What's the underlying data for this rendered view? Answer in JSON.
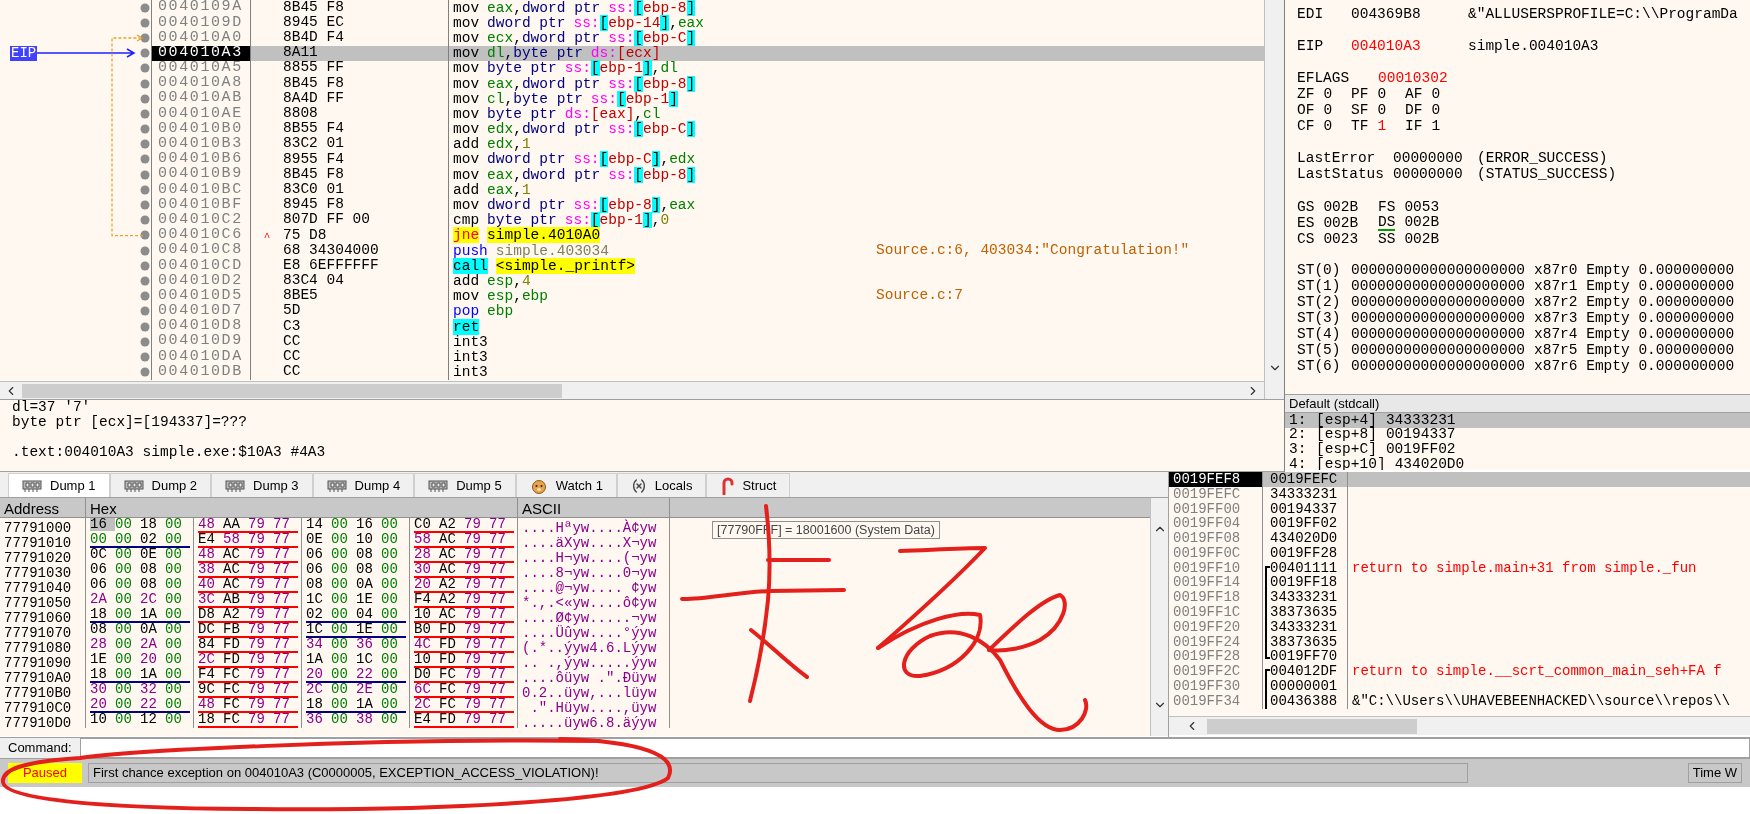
{
  "disassembly": {
    "rows": [
      {
        "address": "0040109A",
        "bytes": "8B45 F8",
        "tokens": [
          {
            "text": "mov",
            "kind": "mnemonic"
          },
          {
            "text": "eax",
            "kind": "reg"
          },
          {
            "text": ",",
            "kind": "sep"
          },
          {
            "text": "dword ptr",
            "kind": "size"
          },
          {
            "text": "ss:",
            "kind": "seg"
          },
          {
            "text": "[",
            "kind": "bracket"
          },
          {
            "text": "ebp-8",
            "kind": "mem"
          },
          {
            "text": "]",
            "kind": "bracket"
          }
        ],
        "selected": false
      },
      {
        "address": "0040109D",
        "bytes": "8945 EC",
        "tokens": [
          {
            "text": "mov",
            "kind": "mnemonic"
          },
          {
            "text": "dword ptr",
            "kind": "size"
          },
          {
            "text": "ss:",
            "kind": "seg"
          },
          {
            "text": "[",
            "kind": "bracket"
          },
          {
            "text": "ebp-14",
            "kind": "mem"
          },
          {
            "text": "]",
            "kind": "bracket"
          },
          {
            "text": ",",
            "kind": "sep"
          },
          {
            "text": "eax",
            "kind": "reg"
          }
        ],
        "selected": false
      },
      {
        "address": "004010A0",
        "bytes": "8B4D F4",
        "tokens": [
          {
            "text": "mov",
            "kind": "mnemonic"
          },
          {
            "text": "ecx",
            "kind": "reg"
          },
          {
            "text": ",",
            "kind": "sep"
          },
          {
            "text": "dword ptr",
            "kind": "size"
          },
          {
            "text": "ss:",
            "kind": "seg"
          },
          {
            "text": "[",
            "kind": "bracket"
          },
          {
            "text": "ebp-C",
            "kind": "mem"
          },
          {
            "text": "]",
            "kind": "bracket"
          }
        ],
        "selected": false,
        "kind": "jump_target"
      },
      {
        "address": "004010A3",
        "bytes": "8A11",
        "tokens": [
          {
            "text": "mov",
            "kind": "mnemonic"
          },
          {
            "text": "dl",
            "kind": "reg"
          },
          {
            "text": ",",
            "kind": "sep"
          },
          {
            "text": "byte ptr",
            "kind": "size"
          },
          {
            "text": "ds:",
            "kind": "seg"
          },
          {
            "text": "[ecx]",
            "kind": "mem"
          }
        ],
        "selected": true,
        "eip_label": "EIP"
      },
      {
        "address": "004010A5",
        "bytes": "8855 FF",
        "tokens": [
          {
            "text": "mov",
            "kind": "mnemonic"
          },
          {
            "text": "byte ptr",
            "kind": "size"
          },
          {
            "text": "ss:",
            "kind": "seg"
          },
          {
            "text": "[",
            "kind": "bracket"
          },
          {
            "text": "ebp-1",
            "kind": "mem"
          },
          {
            "text": "]",
            "kind": "bracket"
          },
          {
            "text": ",",
            "kind": "sep"
          },
          {
            "text": "dl",
            "kind": "reg"
          }
        ],
        "selected": false
      },
      {
        "address": "004010A8",
        "bytes": "8B45 F8",
        "tokens": [
          {
            "text": "mov",
            "kind": "mnemonic"
          },
          {
            "text": "eax",
            "kind": "reg"
          },
          {
            "text": ",",
            "kind": "sep"
          },
          {
            "text": "dword ptr",
            "kind": "size"
          },
          {
            "text": "ss:",
            "kind": "seg"
          },
          {
            "text": "[",
            "kind": "bracket"
          },
          {
            "text": "ebp-8",
            "kind": "mem"
          },
          {
            "text": "]",
            "kind": "bracket"
          }
        ],
        "selected": false
      },
      {
        "address": "004010AB",
        "bytes": "8A4D FF",
        "tokens": [
          {
            "text": "mov",
            "kind": "mnemonic"
          },
          {
            "text": "cl",
            "kind": "reg"
          },
          {
            "text": ",",
            "kind": "sep"
          },
          {
            "text": "byte ptr",
            "kind": "size"
          },
          {
            "text": "ss:",
            "kind": "seg"
          },
          {
            "text": "[",
            "kind": "bracket"
          },
          {
            "text": "ebp-1",
            "kind": "mem"
          },
          {
            "text": "]",
            "kind": "bracket"
          }
        ],
        "selected": false
      },
      {
        "address": "004010AE",
        "bytes": "8808",
        "tokens": [
          {
            "text": "mov",
            "kind": "mnemonic"
          },
          {
            "text": "byte ptr",
            "kind": "size"
          },
          {
            "text": "ds:",
            "kind": "seg"
          },
          {
            "text": "[eax]",
            "kind": "mem"
          },
          {
            "text": ",",
            "kind": "sep"
          },
          {
            "text": "cl",
            "kind": "reg"
          }
        ],
        "selected": false
      },
      {
        "address": "004010B0",
        "bytes": "8B55 F4",
        "tokens": [
          {
            "text": "mov",
            "kind": "mnemonic"
          },
          {
            "text": "edx",
            "kind": "reg"
          },
          {
            "text": ",",
            "kind": "sep"
          },
          {
            "text": "dword ptr",
            "kind": "size"
          },
          {
            "text": "ss:",
            "kind": "seg"
          },
          {
            "text": "[",
            "kind": "bracket"
          },
          {
            "text": "ebp-C",
            "kind": "mem"
          },
          {
            "text": "]",
            "kind": "bracket"
          }
        ],
        "selected": false
      },
      {
        "address": "004010B3",
        "bytes": "83C2 01",
        "tokens": [
          {
            "text": "add",
            "kind": "mnemonic"
          },
          {
            "text": "edx",
            "kind": "reg"
          },
          {
            "text": ",",
            "kind": "sep"
          },
          {
            "text": "1",
            "kind": "num"
          }
        ],
        "selected": false
      },
      {
        "address": "004010B6",
        "bytes": "8955 F4",
        "tokens": [
          {
            "text": "mov",
            "kind": "mnemonic"
          },
          {
            "text": "dword ptr",
            "kind": "size"
          },
          {
            "text": "ss:",
            "kind": "seg"
          },
          {
            "text": "[",
            "kind": "bracket"
          },
          {
            "text": "ebp-C",
            "kind": "mem"
          },
          {
            "text": "]",
            "kind": "bracket"
          },
          {
            "text": ",",
            "kind": "sep"
          },
          {
            "text": "edx",
            "kind": "reg"
          }
        ],
        "selected": false
      },
      {
        "address": "004010B9",
        "bytes": "8B45 F8",
        "tokens": [
          {
            "text": "mov",
            "kind": "mnemonic"
          },
          {
            "text": "eax",
            "kind": "reg"
          },
          {
            "text": ",",
            "kind": "sep"
          },
          {
            "text": "dword ptr",
            "kind": "size"
          },
          {
            "text": "ss:",
            "kind": "seg"
          },
          {
            "text": "[",
            "kind": "bracket"
          },
          {
            "text": "ebp-8",
            "kind": "mem"
          },
          {
            "text": "]",
            "kind": "bracket"
          }
        ],
        "selected": false
      },
      {
        "address": "004010BC",
        "bytes": "83C0 01",
        "tokens": [
          {
            "text": "add",
            "kind": "mnemonic"
          },
          {
            "text": "eax",
            "kind": "reg"
          },
          {
            "text": ",",
            "kind": "sep"
          },
          {
            "text": "1",
            "kind": "num"
          }
        ],
        "selected": false
      },
      {
        "address": "004010BF",
        "bytes": "8945 F8",
        "tokens": [
          {
            "text": "mov",
            "kind": "mnemonic"
          },
          {
            "text": "dword ptr",
            "kind": "size"
          },
          {
            "text": "ss:",
            "kind": "seg"
          },
          {
            "text": "[",
            "kind": "bracket"
          },
          {
            "text": "ebp-8",
            "kind": "mem"
          },
          {
            "text": "]",
            "kind": "bracket"
          },
          {
            "text": ",",
            "kind": "sep"
          },
          {
            "text": "eax",
            "kind": "reg"
          }
        ],
        "selected": false
      },
      {
        "address": "004010C2",
        "bytes": "807D FF 00",
        "tokens": [
          {
            "text": "cmp",
            "kind": "mnemonic"
          },
          {
            "text": "byte ptr",
            "kind": "size"
          },
          {
            "text": "ss:",
            "kind": "seg"
          },
          {
            "text": "[",
            "kind": "bracket"
          },
          {
            "text": "ebp-1",
            "kind": "mem"
          },
          {
            "text": "]",
            "kind": "bracket"
          },
          {
            "text": ",",
            "kind": "sep"
          },
          {
            "text": "0",
            "kind": "num"
          }
        ],
        "selected": false
      },
      {
        "address": "004010C6",
        "bytes": "75 D8",
        "marker": "^",
        "tokens": [
          {
            "text": "jne",
            "kind": "jump"
          },
          {
            "text": "simple.4010A0",
            "kind": "target"
          }
        ],
        "selected": false,
        "kind": "jump_source"
      },
      {
        "address": "004010C8",
        "bytes": "68 34304000",
        "tokens": [
          {
            "text": "push",
            "kind": "stack_op"
          },
          {
            "text": "simple.403034",
            "kind": "addr"
          }
        ],
        "comment": "Source.c:6, 403034:\"Congratulation!\"",
        "selected": false
      },
      {
        "address": "004010CD",
        "bytes": "E8 6EFFFFFF",
        "tokens": [
          {
            "text": "call",
            "kind": "call"
          },
          {
            "text": "<simple._printf>",
            "kind": "target"
          }
        ],
        "selected": false
      },
      {
        "address": "004010D2",
        "bytes": "83C4 04",
        "tokens": [
          {
            "text": "add",
            "kind": "mnemonic"
          },
          {
            "text": "esp",
            "kind": "reg"
          },
          {
            "text": ",",
            "kind": "sep"
          },
          {
            "text": "4",
            "kind": "num"
          }
        ],
        "selected": false
      },
      {
        "address": "004010D5",
        "bytes": "8BE5",
        "tokens": [
          {
            "text": "mov",
            "kind": "mnemonic"
          },
          {
            "text": "esp",
            "kind": "reg"
          },
          {
            "text": ",",
            "kind": "sep"
          },
          {
            "text": "ebp",
            "kind": "reg"
          }
        ],
        "comment": "Source.c:7",
        "selected": false
      },
      {
        "address": "004010D7",
        "bytes": "5D",
        "tokens": [
          {
            "text": "pop",
            "kind": "stack_op"
          },
          {
            "text": "ebp",
            "kind": "reg"
          }
        ],
        "selected": false
      },
      {
        "address": "004010D8",
        "bytes": "C3",
        "tokens": [
          {
            "text": "ret",
            "kind": "ret"
          }
        ],
        "selected": false
      },
      {
        "address": "004010D9",
        "bytes": "CC",
        "tokens": [
          {
            "text": "int3",
            "kind": "mnemonic"
          }
        ],
        "selected": false
      },
      {
        "address": "004010DA",
        "bytes": "CC",
        "tokens": [
          {
            "text": "int3",
            "kind": "mnemonic"
          }
        ],
        "selected": false
      },
      {
        "address": "004010DB",
        "bytes": "CC",
        "tokens": [
          {
            "text": "int3",
            "kind": "mnemonic"
          }
        ],
        "selected": false
      }
    ]
  },
  "registers": {
    "groups": [
      {
        "rows": [
          {
            "kind": "register",
            "name": "EDI",
            "value": "004369B8",
            "info": "&\"ALLUSERSPROFILE=C:\\\\ProgramDa",
            "changed": false
          }
        ]
      },
      {
        "rows": [
          {
            "kind": "register",
            "name": "EIP",
            "value": "004010A3",
            "info": "simple.004010A3",
            "changed": true
          }
        ]
      },
      {
        "rows": [
          {
            "kind": "eflags",
            "name": "EFLAGS",
            "value": "00010302",
            "changed": true
          },
          {
            "kind": "flags",
            "cells": [
              {
                "name": "ZF",
                "value": "0",
                "changed": false
              },
              {
                "name": "PF",
                "value": "0",
                "changed": false
              },
              {
                "name": "AF",
                "value": "0",
                "changed": false
              }
            ]
          },
          {
            "kind": "flags",
            "cells": [
              {
                "name": "OF",
                "value": "0",
                "changed": false
              },
              {
                "name": "SF",
                "value": "0",
                "changed": false
              },
              {
                "name": "DF",
                "value": "0",
                "changed": false
              }
            ]
          },
          {
            "kind": "flags",
            "cells": [
              {
                "name": "CF",
                "value": "0",
                "changed": false
              },
              {
                "name": "TF",
                "value": "1",
                "changed": true
              },
              {
                "name": "IF",
                "value": "1",
                "changed": false
              }
            ]
          }
        ]
      },
      {
        "rows": [
          {
            "kind": "error",
            "name": "LastError",
            "value": "00000000",
            "info": "(ERROR_SUCCESS)"
          },
          {
            "kind": "error",
            "name": "LastStatus",
            "value": "00000000",
            "info": "(STATUS_SUCCESS)"
          }
        ]
      },
      {
        "rows": [
          {
            "kind": "segments",
            "cells": [
              {
                "name": "GS",
                "value": "002B",
                "highlighted": false
              },
              {
                "name": "FS",
                "value": "0053",
                "highlighted": false
              }
            ]
          },
          {
            "kind": "segments",
            "cells": [
              {
                "name": "ES",
                "value": "002B",
                "highlighted": false
              },
              {
                "name": "DS",
                "value": "002B",
                "highlighted": true
              }
            ]
          },
          {
            "kind": "segments",
            "cells": [
              {
                "name": "CS",
                "value": "0023",
                "highlighted": false
              },
              {
                "name": "SS",
                "value": "002B",
                "highlighted": false
              }
            ]
          }
        ]
      },
      {
        "rows": [
          {
            "kind": "fpu",
            "name": "ST(0)",
            "value": "00000000000000000000",
            "info": "x87r0 Empty 0.000000000"
          },
          {
            "kind": "fpu",
            "name": "ST(1)",
            "value": "00000000000000000000",
            "info": "x87r1 Empty 0.000000000"
          },
          {
            "kind": "fpu",
            "name": "ST(2)",
            "value": "00000000000000000000",
            "info": "x87r2 Empty 0.000000000"
          },
          {
            "kind": "fpu",
            "name": "ST(3)",
            "value": "00000000000000000000",
            "info": "x87r3 Empty 0.000000000"
          },
          {
            "kind": "fpu",
            "name": "ST(4)",
            "value": "00000000000000000000",
            "info": "x87r4 Empty 0.000000000"
          },
          {
            "kind": "fpu",
            "name": "ST(5)",
            "value": "00000000000000000000",
            "info": "x87r5 Empty 0.000000000"
          },
          {
            "kind": "fpu",
            "name": "ST(6)",
            "value": "00000000000000000000",
            "info": "x87r6 Empty 0.000000000"
          }
        ]
      }
    ]
  },
  "info": {
    "lines": [
      "dl=37 '7'",
      "byte ptr [ecx]=[194337]=???"
    ],
    "location": ".text:004010A3 simple.exe:$10A3 #4A3"
  },
  "call_args": {
    "title": "Default (stdcall)",
    "rows": [
      {
        "index": "1:",
        "slot": "[esp+4]",
        "value": "34333231",
        "selected": true
      },
      {
        "index": "2:",
        "slot": "[esp+8]",
        "value": "00194337",
        "selected": false
      },
      {
        "index": "3:",
        "slot": "[esp+C]",
        "value": "0019FF02",
        "selected": false
      },
      {
        "index": "4:",
        "slot": "[esp+10]",
        "value": "434020D0",
        "selected": false
      }
    ]
  },
  "tabs": [
    {
      "label": "Dump 1",
      "kind": "dump",
      "selected": true
    },
    {
      "label": "Dump 2",
      "kind": "dump",
      "selected": false
    },
    {
      "label": "Dump 3",
      "kind": "dump",
      "selected": false
    },
    {
      "label": "Dump 4",
      "kind": "dump",
      "selected": false
    },
    {
      "label": "Dump 5",
      "kind": "dump",
      "selected": false
    },
    {
      "label": "Watch 1",
      "kind": "watch",
      "selected": false
    },
    {
      "label": "Locals",
      "kind": "locals",
      "selected": false
    },
    {
      "label": "Struct",
      "kind": "struct",
      "selected": false
    }
  ],
  "dump": {
    "columns": [
      "Address",
      "Hex",
      "ASCII"
    ],
    "tooltip": "[77790FFF] = 18001600 (System Data)",
    "rows": [
      {
        "address": "77791000",
        "groups": [
          {
            "bytes": "16 00 18 00"
          },
          {
            "bytes": "48 AA 79 77",
            "color": "#ff0000"
          },
          {
            "bytes": "14 00 16 00"
          },
          {
            "bytes": "C0 A2 79 77",
            "color": "#ff0000"
          }
        ],
        "ascii": "....Hªyw....À¢yw",
        "cursor": true
      },
      {
        "address": "77791010",
        "groups": [
          {
            "bytes": "00 00 02 00",
            "color": "#000080"
          },
          {
            "bytes": "E4 58 79 77",
            "color": "#ff0000"
          },
          {
            "bytes": "0E 00 10 00"
          },
          {
            "bytes": "58 AC 79 77",
            "color": "#ff0000"
          }
        ],
        "ascii": "....äXyw....X¬yw",
        "cursor": false
      },
      {
        "address": "77791020",
        "groups": [
          {
            "bytes": "0C 00 0E 00"
          },
          {
            "bytes": "48 AC 79 77",
            "color": "#ff0000"
          },
          {
            "bytes": "06 00 08 00"
          },
          {
            "bytes": "28 AC 79 77",
            "color": "#ff0000"
          }
        ],
        "ascii": "....H¬yw....(¬yw",
        "cursor": false
      },
      {
        "address": "77791030",
        "groups": [
          {
            "bytes": "06 00 08 00"
          },
          {
            "bytes": "38 AC 79 77",
            "color": "#ff0000"
          },
          {
            "bytes": "06 00 08 00"
          },
          {
            "bytes": "30 AC 79 77",
            "color": "#ff0000"
          }
        ],
        "ascii": "....8¬yw....0¬yw",
        "cursor": false
      },
      {
        "address": "77791040",
        "groups": [
          {
            "bytes": "06 00 08 00"
          },
          {
            "bytes": "40 AC 79 77",
            "color": "#ff0000"
          },
          {
            "bytes": "08 00 0A 00"
          },
          {
            "bytes": "20 A2 79 77",
            "color": "#ff0000"
          }
        ],
        "ascii": "....@¬yw.... ¢yw",
        "cursor": false
      },
      {
        "address": "77791050",
        "groups": [
          {
            "bytes": "2A 00 2C 00"
          },
          {
            "bytes": "3C AB 79 77",
            "color": "#ff0000"
          },
          {
            "bytes": "1C 00 1E 00"
          },
          {
            "bytes": "F4 A2 79 77",
            "color": "#ff0000"
          }
        ],
        "ascii": "*.,.<«yw....ô¢yw",
        "cursor": false
      },
      {
        "address": "77791060",
        "groups": [
          {
            "bytes": "18 00 1A 00",
            "color": "#000080"
          },
          {
            "bytes": "D8 A2 79 77",
            "color": "#ff0000"
          },
          {
            "bytes": "02 00 04 00",
            "color": "#000080"
          },
          {
            "bytes": "10 AC 79 77",
            "color": "#ff0000"
          }
        ],
        "ascii": "....Ø¢yw.....¬yw",
        "cursor": false
      },
      {
        "address": "77791070",
        "groups": [
          {
            "bytes": "08 00 0A 00"
          },
          {
            "bytes": "DC FB 79 77",
            "color": "#ff0000"
          },
          {
            "bytes": "1C 00 1E 00",
            "color": "#000080"
          },
          {
            "bytes": "B0 FD 79 77",
            "color": "#ff0000"
          }
        ],
        "ascii": "....Üûyw....°ýyw",
        "cursor": false
      },
      {
        "address": "77791080",
        "groups": [
          {
            "bytes": "28 00 2A 00"
          },
          {
            "bytes": "84 FD 79 77",
            "color": "#ff0000"
          },
          {
            "bytes": "34 00 36 00"
          },
          {
            "bytes": "4C FD 79 77",
            "color": "#ff0000"
          }
        ],
        "ascii": "(.*..ýyw4.6.Lýyw",
        "cursor": false
      },
      {
        "address": "77791090",
        "groups": [
          {
            "bytes": "1E 00 20 00"
          },
          {
            "bytes": "2C FD 79 77",
            "color": "#ff0000"
          },
          {
            "bytes": "1A 00 1C 00"
          },
          {
            "bytes": "10 FD 79 77",
            "color": "#ff0000"
          }
        ],
        "ascii": ".. .,ýyw.....ýyw",
        "cursor": false
      },
      {
        "address": "777910A0",
        "groups": [
          {
            "bytes": "18 00 1A 00",
            "color": "#000080"
          },
          {
            "bytes": "F4 FC 79 77",
            "color": "#ff0000"
          },
          {
            "bytes": "20 00 22 00",
            "color": "#000080"
          },
          {
            "bytes": "D0 FC 79 77",
            "color": "#ff0000"
          }
        ],
        "ascii": "....ôüyw .\".Ðüyw",
        "cursor": false
      },
      {
        "address": "777910B0",
        "groups": [
          {
            "bytes": "30 00 32 00"
          },
          {
            "bytes": "9C FC 79 77",
            "color": "#ff0000"
          },
          {
            "bytes": "2C 00 2E 00"
          },
          {
            "bytes": "6C FC 79 77",
            "color": "#ff0000"
          }
        ],
        "ascii": "0.2..üyw,...lüyw",
        "cursor": false
      },
      {
        "address": "777910C0",
        "groups": [
          {
            "bytes": "20 00 22 00",
            "color": "#000080"
          },
          {
            "bytes": "48 FC 79 77",
            "color": "#ff0000"
          },
          {
            "bytes": "18 00 1A 00",
            "color": "#000080"
          },
          {
            "bytes": "2C FC 79 77",
            "color": "#ff0000"
          }
        ],
        "ascii": " .\".Hüyw....,üyw",
        "cursor": false
      },
      {
        "address": "777910D0",
        "groups": [
          {
            "bytes": "10 00 12 00"
          },
          {
            "bytes": "18 FC 79 77",
            "color": "#ff0000"
          },
          {
            "bytes": "36 00 38 00"
          },
          {
            "bytes": "E4 FD 79 77",
            "color": "#ff0000"
          }
        ],
        "ascii": ".....üyw6.8.äýyw",
        "cursor": false
      }
    ]
  },
  "stack": {
    "rows": [
      {
        "address": "0019FEF8",
        "value": "0019FEFC",
        "selected": true
      },
      {
        "address": "0019FEFC",
        "value": "34333231",
        "selected": false
      },
      {
        "address": "0019FF00",
        "value": "00194337",
        "selected": false
      },
      {
        "address": "0019FF04",
        "value": "0019FF02",
        "selected": false
      },
      {
        "address": "0019FF08",
        "value": "434020D0",
        "selected": false
      },
      {
        "address": "0019FF0C",
        "value": "0019FF28",
        "selected": false
      },
      {
        "address": "0019FF10",
        "value": "00401111",
        "kind": "frame_start",
        "comment": {
          "text": "return to simple.main+31 from simple._fun",
          "kind": "return"
        },
        "selected": false
      },
      {
        "address": "0019FF14",
        "value": "0019FF18",
        "kind": "frame_mid",
        "selected": false
      },
      {
        "address": "0019FF18",
        "value": "34333231",
        "kind": "frame_mid",
        "selected": false
      },
      {
        "address": "0019FF1C",
        "value": "38373635",
        "kind": "frame_mid",
        "selected": false
      },
      {
        "address": "0019FF20",
        "value": "34333231",
        "kind": "frame_mid",
        "selected": false
      },
      {
        "address": "0019FF24",
        "value": "38373635",
        "kind": "frame_mid",
        "selected": false
      },
      {
        "address": "0019FF28",
        "value": "0019FF70",
        "kind": "frame_end",
        "selected": false
      },
      {
        "address": "0019FF2C",
        "value": "004012DF",
        "kind": "frame_start",
        "comment": {
          "text": "return to simple.__scrt_common_main_seh+FA f",
          "kind": "return"
        },
        "selected": false
      },
      {
        "address": "0019FF30",
        "value": "00000001",
        "kind": "frame_mid",
        "selected": false
      },
      {
        "address": "0019FF34",
        "value": "00436388",
        "kind": "frame_mid",
        "comment": {
          "text": "&\"C:\\\\Users\\\\UHAVEBEENHACKED\\\\source\\\\repos\\\\",
          "kind": "string"
        },
        "selected": false
      }
    ]
  },
  "command": {
    "label": "Command:"
  },
  "status_bar": {
    "state": "Paused",
    "message": "First chance exception on 004010A3 (C0000005, EXCEPTION_ACCESS_VIOLATION)!",
    "timer_label": "Time W"
  }
}
